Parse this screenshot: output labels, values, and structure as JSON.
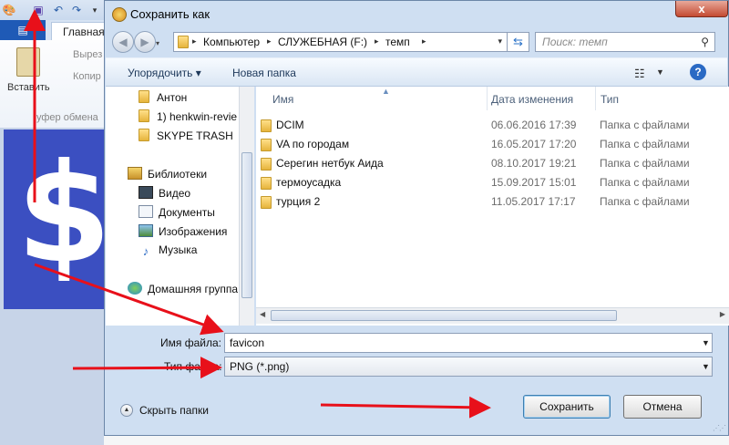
{
  "paint": {
    "file_tab": "▤",
    "home_tab": "Главная",
    "paste_label": "Вставить",
    "cut_label": "Вырез",
    "copy_label": "Копир",
    "clipboard_label": "уфер обмена",
    "canvas_symbol": "$"
  },
  "dialog": {
    "title": "Сохранить как",
    "close": "x",
    "breadcrumbs": [
      "Компьютер",
      "СЛУЖЕБНАЯ (F:)",
      "темп"
    ],
    "search_placeholder": "Поиск: темп",
    "toolbar": {
      "organize": "Упорядочить ▾",
      "new_folder": "Новая папка"
    },
    "nav_items": [
      {
        "label": "Антон",
        "icon": "folder-icon"
      },
      {
        "label": "1) henkwin-revie",
        "icon": "folder-icon"
      },
      {
        "label": "SKYPE TRASH",
        "icon": "folder-icon"
      },
      {
        "label": "Библиотеки",
        "icon": "library-icon"
      },
      {
        "label": "Видео",
        "icon": "video-icon"
      },
      {
        "label": "Документы",
        "icon": "documents-icon"
      },
      {
        "label": "Изображения",
        "icon": "images-icon"
      },
      {
        "label": "Музыка",
        "icon": "music-icon"
      },
      {
        "label": "Домашняя группа",
        "icon": "homegroup-icon"
      }
    ],
    "columns": [
      "Имя",
      "Дата изменения",
      "Тип"
    ],
    "files": [
      {
        "name": "DCIM",
        "date": "06.06.2016 17:39",
        "type": "Папка с файлами"
      },
      {
        "name": "VA по городам",
        "date": "16.05.2017 17:20",
        "type": "Папка с файлами"
      },
      {
        "name": "Серегин нетбук Аида",
        "date": "08.10.2017 19:21",
        "type": "Папка с файлами"
      },
      {
        "name": "термоусадка",
        "date": "15.09.2017 15:01",
        "type": "Папка с файлами"
      },
      {
        "name": "турция 2",
        "date": "11.05.2017 17:17",
        "type": "Папка с файлами"
      }
    ],
    "filename_label": "Имя файла:",
    "filename_value": "favicon",
    "filetype_label": "Тип файла:",
    "filetype_value": "PNG (*.png)",
    "hide_folders": "Скрыть папки",
    "save": "Сохранить",
    "cancel": "Отмена"
  },
  "colors": {
    "arrow": "#e8101a",
    "accent": "#1f5ab6"
  }
}
